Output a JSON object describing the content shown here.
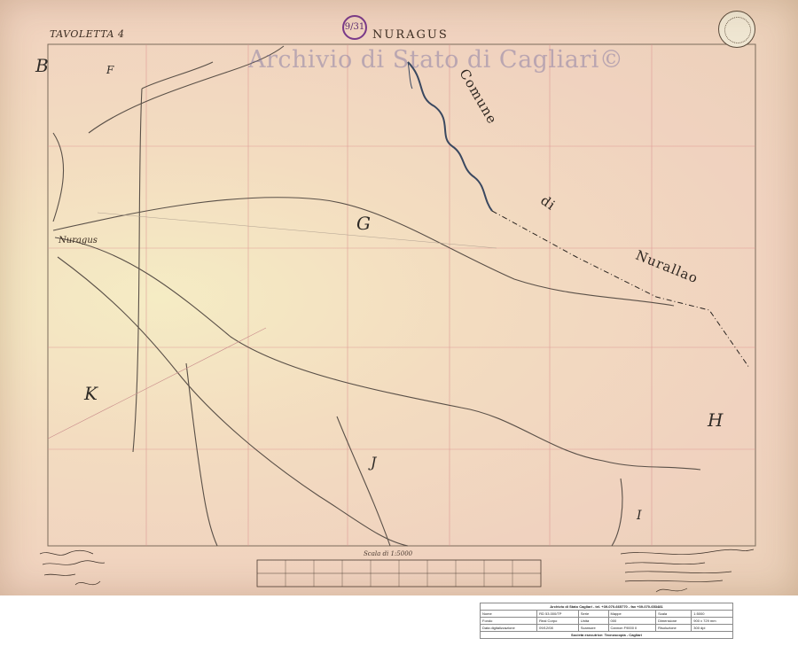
{
  "map": {
    "tavoletta": "TAVOLETTA 4",
    "sheet_name": "NURAGUS",
    "sheet_number": "9/31",
    "watermark": "Archivio di Stato di Cagliari©",
    "comune_label": [
      "Comune",
      "di",
      "Nurallao"
    ],
    "town_label": "Nuragus",
    "zones": [
      "B",
      "F",
      "G",
      "K",
      "J",
      "H",
      "I"
    ],
    "scale_label": "Scala di 1:5000"
  },
  "archive_table": {
    "header": "Archivio di Stato Cagliari - tel. +39-070-665770 - fax +39-070-653481",
    "rows": [
      [
        "Nome",
        "RD 53.000/TP",
        "Serie",
        "Mappe",
        "Scala",
        "1:5000"
      ],
      [
        "Fondo",
        "Real Corpo",
        "Unità",
        "000",
        "Dimensione",
        "900 x 729 mm"
      ],
      [
        "Data digitalizzazione",
        "09/12/08",
        "Scansore",
        "Cannon F9000 II",
        "Risoluzione",
        "300 dpi"
      ]
    ],
    "footer": "Società esecutrice: Tecnoscopia - Cagliari"
  }
}
